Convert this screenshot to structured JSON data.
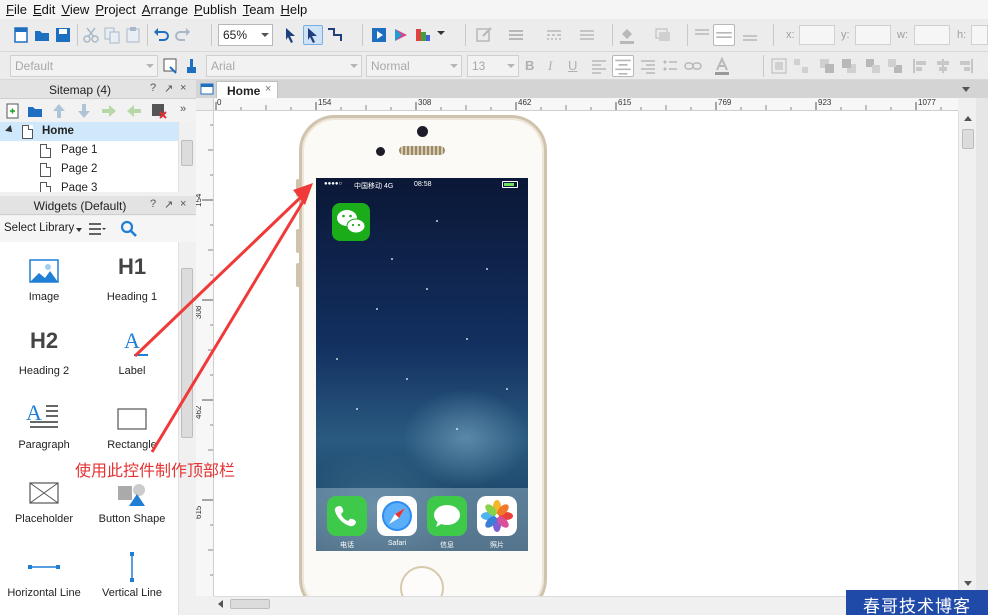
{
  "menu": [
    "File",
    "Edit",
    "View",
    "Project",
    "Arrange",
    "Publish",
    "Team",
    "Help"
  ],
  "toolbar": {
    "zoom": "65%",
    "coords": {
      "x_label": "x:",
      "y_label": "y:",
      "w_label": "w:",
      "h_label": "h:"
    }
  },
  "format_bar": {
    "style": "Default",
    "font": "Arial",
    "weight": "Normal",
    "size": "13",
    "bold_label": "B",
    "italic_label": "I",
    "underline_label": "U"
  },
  "sitemap": {
    "title": "Sitemap (4)",
    "controls": [
      "?",
      "↗",
      "×"
    ],
    "pages": [
      {
        "label": "Home",
        "selected": true
      },
      {
        "label": "Page 1"
      },
      {
        "label": "Page 2"
      },
      {
        "label": "Page 3"
      }
    ]
  },
  "widgets": {
    "title": "Widgets (Default)",
    "controls": [
      "?",
      "↗",
      "×"
    ],
    "select_library": "Select Library",
    "items": [
      {
        "label": "Image",
        "icon": "image-icon"
      },
      {
        "label": "Heading 1",
        "icon": "heading1-icon",
        "glyph": "H1"
      },
      {
        "label": "Heading 2",
        "icon": "heading2-icon",
        "glyph": "H2"
      },
      {
        "label": "Label",
        "icon": "label-icon",
        "glyph": "A"
      },
      {
        "label": "Paragraph",
        "icon": "paragraph-icon",
        "glyph": "A"
      },
      {
        "label": "Rectangle",
        "icon": "rectangle-icon"
      },
      {
        "label": "Placeholder",
        "icon": "placeholder-icon"
      },
      {
        "label": "Button Shape",
        "icon": "button-shape-icon"
      },
      {
        "label": "Horizontal Line",
        "icon": "horizontal-line-icon"
      },
      {
        "label": "Vertical Line",
        "icon": "vertical-line-icon"
      }
    ]
  },
  "tab": {
    "label": "Home",
    "close": "×"
  },
  "rulers": {
    "h": [
      "0",
      "154",
      "308",
      "462",
      "615",
      "769",
      "923",
      "1077"
    ],
    "v": [
      "154",
      "308",
      "462",
      "615"
    ]
  },
  "phone": {
    "status": {
      "signal": "●●●●○",
      "carrier": "中国移动 4G",
      "time": "08:58"
    },
    "dock": [
      "电话",
      "Safari",
      "信息",
      "照片"
    ]
  },
  "annotation": "使用此控件制作顶部栏",
  "watermark": "春哥技术博客",
  "colors": {
    "arrow": "#f03a3a",
    "accent": "#1f7fd4",
    "wechat": "#1aad19"
  }
}
